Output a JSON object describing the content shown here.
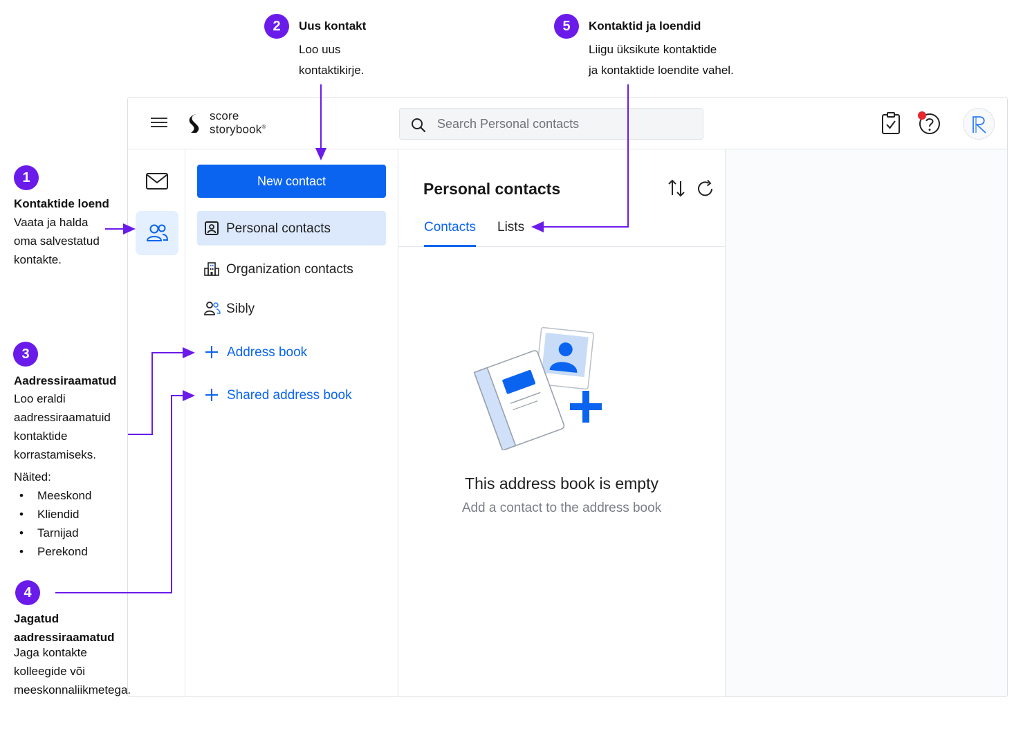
{
  "app": {
    "logo": {
      "line1": "score",
      "line2": "storybook",
      "mark": "®"
    },
    "search": {
      "placeholder": "Search Personal contacts"
    },
    "nav": {
      "new_contact": "New contact",
      "items": [
        {
          "label": "Personal contacts",
          "icon": "contact-card-icon",
          "active": true
        },
        {
          "label": "Organization contacts",
          "icon": "building-icon"
        },
        {
          "label": "Sibly",
          "icon": "people-icon"
        }
      ],
      "add_address_book": "Address book",
      "add_shared_address_book": "Shared address book"
    },
    "list": {
      "title": "Personal contacts",
      "tabs": [
        "Contacts",
        "Lists"
      ],
      "active_tab": "Contacts",
      "empty_title": "This address book is empty",
      "empty_subtitle": "Add a contact to the address book"
    },
    "colors": {
      "primary": "#0a64f0",
      "active_bg": "#dce9fc",
      "annotation": "#6a1bea",
      "notification": "#e8262c"
    }
  },
  "annotations": {
    "a1": {
      "num": "1",
      "title": "Kontaktide loend",
      "lines": [
        "Vaata ja halda",
        "oma salvestatud",
        "kontakte."
      ]
    },
    "a2": {
      "num": "2",
      "title": "Uus kontakt",
      "lines": [
        "Loo uus",
        "kontaktikirje."
      ]
    },
    "a3": {
      "num": "3",
      "title": "Aadressiraamatud",
      "lines": [
        "Loo eraldi",
        "aadressiraamatuid",
        "kontaktide",
        "korrastamiseks."
      ],
      "examples_label": "Näited:",
      "examples": [
        "Meeskond",
        "Kliendid",
        "Tarnijad",
        "Perekond"
      ]
    },
    "a4": {
      "num": "4",
      "title_lines": [
        "Jagatud",
        "aadressiraamatud"
      ],
      "lines": [
        "Jaga kontakte",
        "kolleegide või",
        "meeskonnaliikmetega."
      ]
    },
    "a5": {
      "num": "5",
      "title": "Kontaktid ja loendid",
      "lines": [
        "Liigu üksikute kontaktide",
        "ja kontaktide loendite vahel."
      ]
    }
  }
}
